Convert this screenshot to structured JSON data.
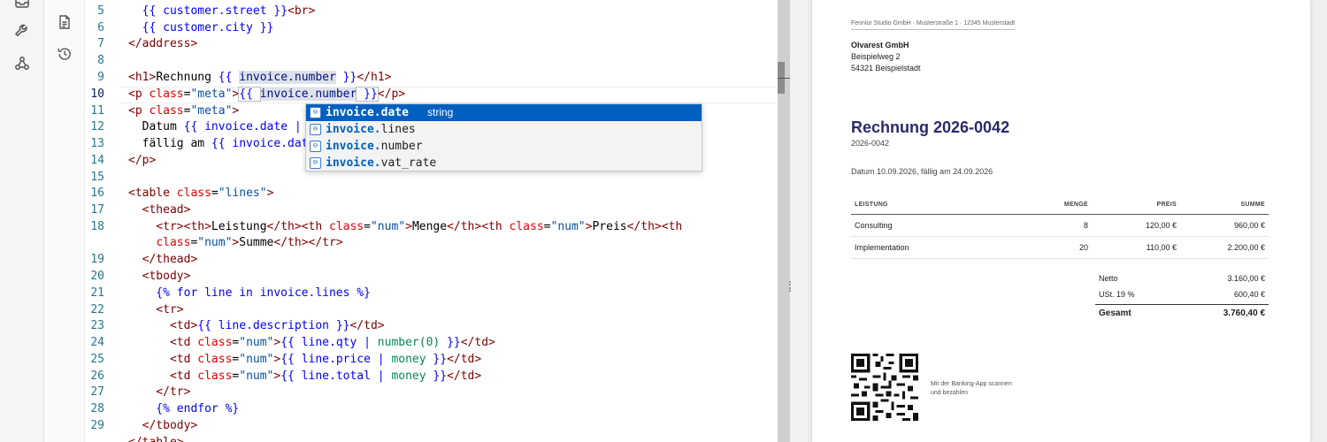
{
  "activity_bar": {
    "icons": [
      "inbox-icon",
      "wrench-icon",
      "webhook-icon"
    ]
  },
  "side_rail": {
    "icons": [
      "document-icon",
      "history-icon"
    ]
  },
  "editor": {
    "active_line": "10",
    "line_numbers": [
      "5",
      "6",
      "7",
      "8",
      "9",
      "10",
      "11",
      "12",
      "13",
      "14",
      "15",
      "16",
      "17",
      "18",
      "19",
      "20",
      "21",
      "22",
      "23",
      "24",
      "25",
      "26",
      "27",
      "28",
      "29"
    ],
    "lines": {
      "l5": [
        "  ",
        "{{ customer.street }}",
        "<br>"
      ],
      "l6": [
        "  ",
        "{{ customer.city }}"
      ],
      "l7": [
        "</address>"
      ],
      "l9a": "<h1>",
      "l9b": "Rechnung ",
      "l9c": "{{ ",
      "l9d": "invoice.number",
      "l9e": " }}",
      "l9f": "</h1>",
      "l10a": "<p ",
      "l10b": "class",
      "l10c": "=",
      "l10d": "\"meta\"",
      "l10e": ">",
      "l10f": "{{ ",
      "l10g": "invoice.number",
      "l10h": " }}",
      "l10i": "</p>",
      "l11a": "<p ",
      "l11b": "class",
      "l11c": "=",
      "l11d": "\"meta\"",
      "l11e": ">",
      "l12a": "  Datum ",
      "l12b": "{{ invoice.date | d",
      "l13a": "  fällig am ",
      "l13b": "{{ invoice.date",
      "l14": "</p>",
      "l16a": "<table ",
      "l16b": "class",
      "l16c": "=",
      "l16d": "\"lines\"",
      "l16e": ">",
      "l17": "  <thead>",
      "l18a": "    <tr><th>",
      "l18b": "Leistung",
      "l18c": "</th><th ",
      "l18d": "class",
      "l18e": "=",
      "l18f": "\"num\"",
      "l18g": ">",
      "l18h": "Menge",
      "l18i": "</th><th ",
      "l18j": "class",
      "l18k": "=",
      "l18l": "\"num\"",
      "l18m": ">",
      "l18n": "Preis",
      "l18o": "</th><th",
      "l18w1": "    ",
      "l18w2": "class",
      "l18w3": "=",
      "l18w4": "\"num\"",
      "l18w5": ">",
      "l18w6": "Summe",
      "l18w7": "</th></tr>",
      "l19": "  </thead>",
      "l20": "  <tbody>",
      "l21": "    {% for line in invoice.lines %}",
      "l22": "    <tr>",
      "l23a": "      <td>",
      "l23b": "{{ line.description }}",
      "l23c": "</td>",
      "l24a": "      <td ",
      "l24b": "class",
      "l24c": "=",
      "l24d": "\"num\"",
      "l24e": ">",
      "l24f": "{{ line.qty | ",
      "l24g": "number(0)",
      "l24h": " }}",
      "l24i": "</td>",
      "l25a": "      <td ",
      "l25b": "class",
      "l25c": "=",
      "l25d": "\"num\"",
      "l25e": ">",
      "l25f": "{{ line.price | ",
      "l25g": "money",
      "l25h": " }}",
      "l25i": "</td>",
      "l26a": "      <td ",
      "l26b": "class",
      "l26c": "=",
      "l26d": "\"num\"",
      "l26e": ">",
      "l26f": "{{ line.total | ",
      "l26g": "money",
      "l26h": " }}",
      "l26i": "</td>",
      "l27": "    </tr>",
      "l28": "    {% endfor %}",
      "l29": "  </tbody>",
      "l30": "</table>"
    }
  },
  "autocomplete": {
    "items": [
      {
        "prefix": "invoice.",
        "rest": "date",
        "type": "string"
      },
      {
        "prefix": "invoice.",
        "rest": "lines"
      },
      {
        "prefix": "invoice.",
        "rest": "number"
      },
      {
        "prefix": "invoice.",
        "rest": "vat_rate"
      }
    ],
    "icon_glyph": "⊖"
  },
  "preview": {
    "sender_line": "Fennlor Studio GmbH · Musterstraße 1 · 12345 Musterstadt",
    "recipient": {
      "name": "Olvarest GmbH",
      "street": "Beispielweg 2",
      "city": "54321 Beispielstadt"
    },
    "title": "Rechnung 2026-0042",
    "meta_number": "2026-0042",
    "meta_dates": "Datum 10.09.2026, fällig am 24.09.2026",
    "table": {
      "headers": [
        "LEISTUNG",
        "MENGE",
        "PREIS",
        "SUMME"
      ],
      "rows": [
        [
          "Consulting",
          "8",
          "120,00 €",
          "960,00 €"
        ],
        [
          "Implementation",
          "20",
          "110,00 €",
          "2.200,00 €"
        ]
      ]
    },
    "totals": {
      "netto_label": "Netto",
      "netto": "3.160,00 €",
      "vat_label": "USt. 19 %",
      "vat": "600,40 €",
      "gross_label": "Gesamt",
      "gross": "3.760,40 €"
    },
    "qr_caption_1": "Mit der Banking-App scannen",
    "qr_caption_2": "und bezahlen"
  },
  "colors": {
    "accent": "#0060c0",
    "title": "#2a2a6a",
    "line_number": "#237893"
  }
}
